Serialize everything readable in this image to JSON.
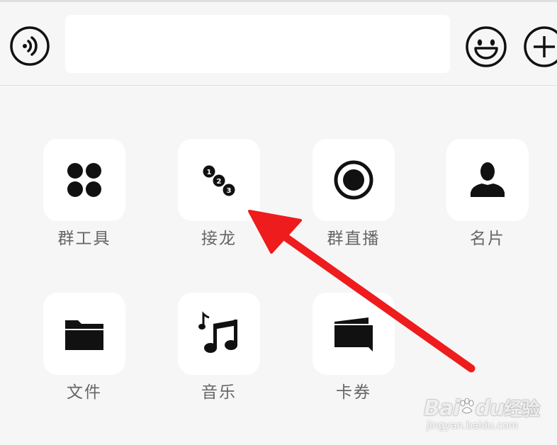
{
  "input_bar": {
    "voice_icon": "voice-input-icon",
    "text_value": "",
    "emoji_icon": "smiley-icon",
    "more_icon": "plus-icon"
  },
  "tools": [
    {
      "label": "群工具",
      "icon": "four-dots-icon"
    },
    {
      "label": "接龙",
      "icon": "numbered-chain-icon"
    },
    {
      "label": "群直播",
      "icon": "record-circle-icon"
    },
    {
      "label": "名片",
      "icon": "person-icon"
    },
    {
      "label": "文件",
      "icon": "folder-icon"
    },
    {
      "label": "音乐",
      "icon": "music-note-icon"
    },
    {
      "label": "卡券",
      "icon": "card-coupon-icon"
    }
  ],
  "chain_badges": [
    "1",
    "2",
    "3"
  ],
  "annotation": {
    "arrow_color": "#ee1c1c",
    "points_to": "接龙"
  },
  "watermark": {
    "brand_latin": "Bai",
    "brand_paw": "du",
    "brand_cn": "经验",
    "url": "jingyan.baidu.com"
  },
  "colors": {
    "background": "#f6f6f6",
    "tile": "#ffffff",
    "icon": "#111111",
    "label": "#666666"
  }
}
